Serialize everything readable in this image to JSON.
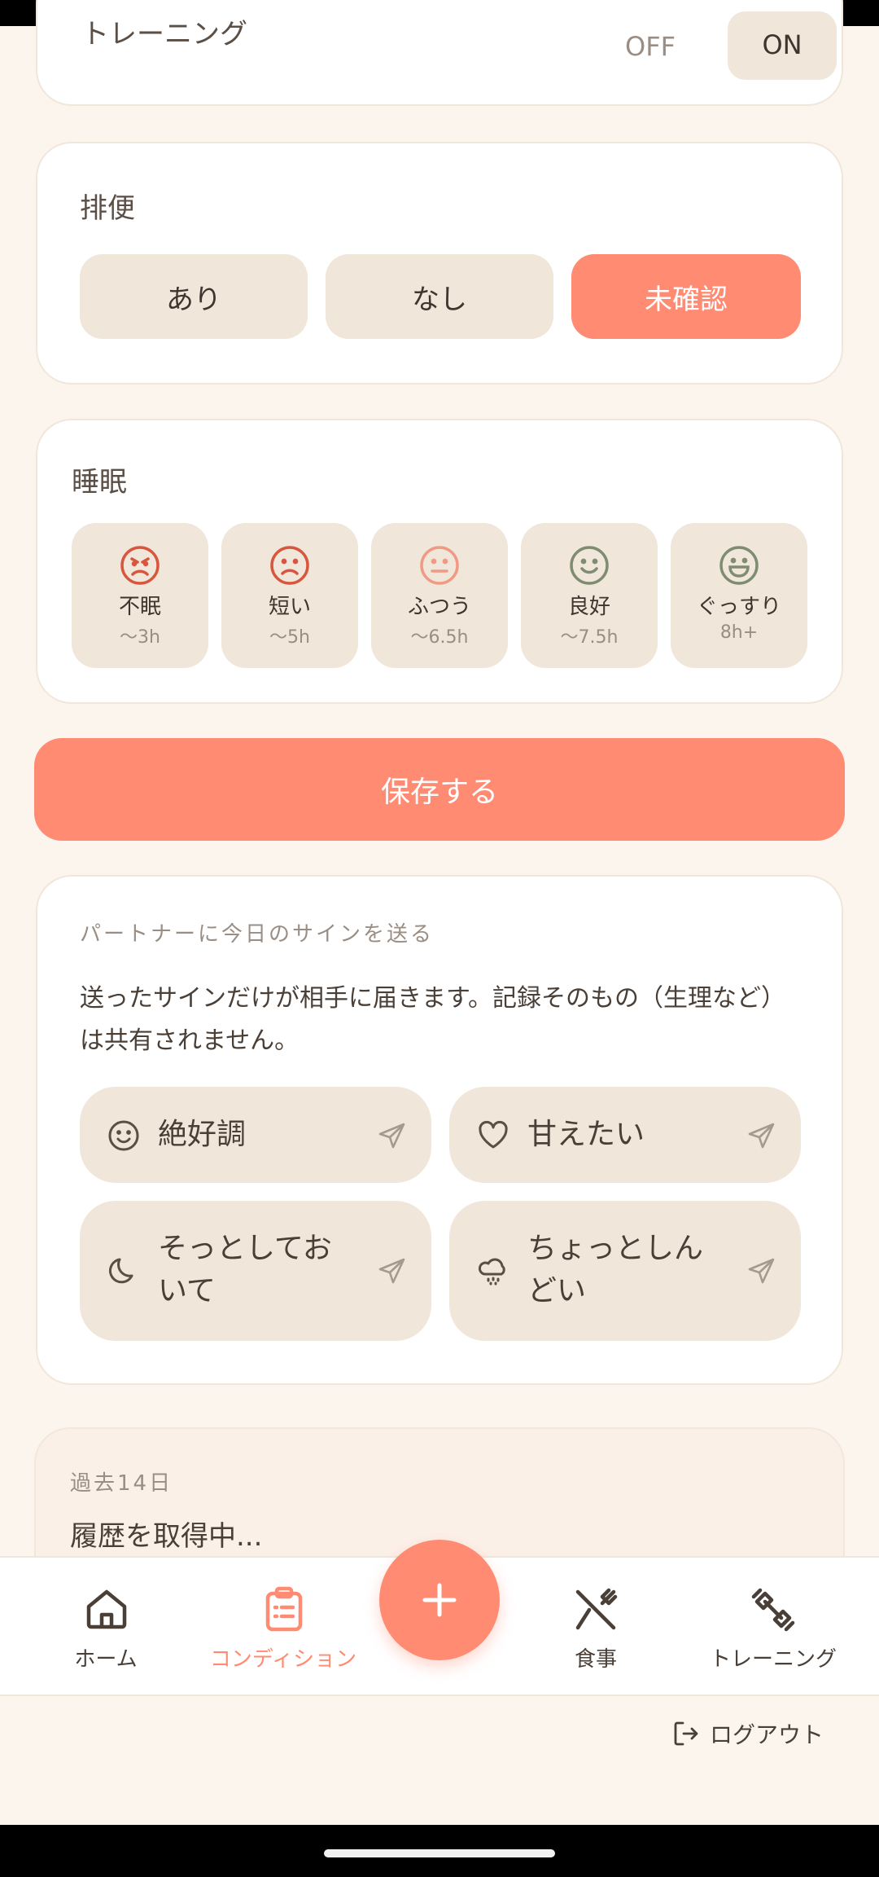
{
  "training_row": {
    "label": "トレーニング",
    "off_label": "OFF",
    "on_label": "ON"
  },
  "bowel": {
    "title": "排便",
    "options": [
      "あり",
      "なし",
      "未確認"
    ],
    "selected": "未確認"
  },
  "sleep": {
    "title": "睡眠",
    "options": [
      {
        "label": "不眠",
        "range": "〜3h",
        "icon": "angry-face-icon",
        "color": "#D9563E"
      },
      {
        "label": "短い",
        "range": "〜5h",
        "icon": "sad-face-icon",
        "color": "#D9563E"
      },
      {
        "label": "ふつう",
        "range": "〜6.5h",
        "icon": "neutral-face-icon",
        "color": "#F09A84"
      },
      {
        "label": "良好",
        "range": "〜7.5h",
        "icon": "smile-face-icon",
        "color": "#7E8C72"
      },
      {
        "label": "ぐっすり",
        "range": "8h+",
        "icon": "grin-face-icon",
        "color": "#7E8C72"
      }
    ]
  },
  "save_label": "保存する",
  "signals": {
    "section_label": "パートナーに今日のサインを送る",
    "description": "送ったサインだけが相手に届きます。記録そのもの（生理など）は共有されません。",
    "buttons": [
      {
        "label": "絶好調",
        "icon": "smile-icon"
      },
      {
        "label": "甘えたい",
        "icon": "heart-icon"
      },
      {
        "label": "そっとしておいて",
        "icon": "moon-icon"
      },
      {
        "label": "ちょっとしんどい",
        "icon": "rain-cloud-icon"
      }
    ]
  },
  "history": {
    "label": "過去14日",
    "loading_text": "履歴を取得中..."
  },
  "tabs": [
    {
      "label": "ホーム",
      "icon": "home-icon"
    },
    {
      "label": "コンディション",
      "icon": "clipboard-icon",
      "active": true
    },
    {
      "label": "食事",
      "icon": "fork-knife-icon"
    },
    {
      "label": "トレーニング",
      "icon": "dumbbell-icon"
    }
  ],
  "fab_icon": "plus-icon",
  "logout_label": "ログアウト",
  "colors": {
    "accent": "#FF8B72",
    "chip": "#F0E6DA",
    "background": "#FCF5EE"
  }
}
